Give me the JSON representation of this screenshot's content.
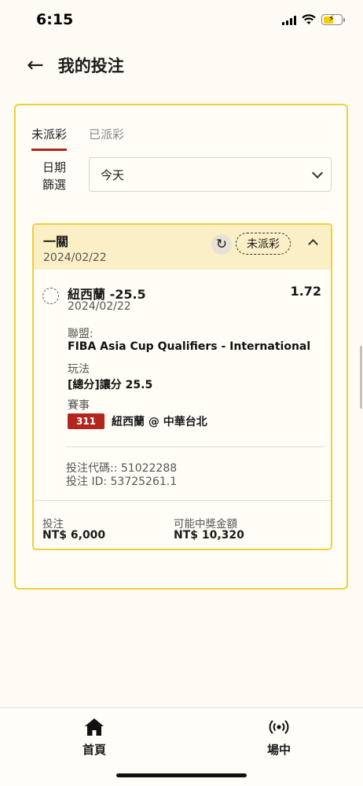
{
  "status_bar": {
    "time": "6:15"
  },
  "header": {
    "title": "我的投注"
  },
  "tabs": [
    {
      "label": "未派彩",
      "active": true
    },
    {
      "label": "已派彩",
      "active": false
    }
  ],
  "filter": {
    "label_line1": "日期",
    "label_line2": "篩選",
    "value": "今天"
  },
  "bet": {
    "type": "一關",
    "date": "2024/02/22",
    "status": "未派彩",
    "selection": "紐西蘭 -25.5",
    "odds": "1.72",
    "selection_date": "2024/02/22",
    "league_label": "聯盟:",
    "league": "FIBA Asia Cup Qualifiers - International",
    "market_label": "玩法",
    "market": "[總分]讓分 25.5",
    "event_label": "賽事",
    "event_code": "311",
    "event": "紐西蘭 @ 中華台北",
    "bet_code": "投注代碼:: 51022288",
    "bet_id": "投注 ID: 53725261.1",
    "stake_label": "投注",
    "stake": "NT$ 6,000",
    "payout_label": "可能中獎金額",
    "payout": "NT$ 10,320"
  },
  "nav": [
    {
      "label": "首頁",
      "icon": "home-icon"
    },
    {
      "label": "場中",
      "icon": "live-broadcast-icon"
    }
  ],
  "colors": {
    "accent": "#b3261e",
    "border": "#f2cf3a",
    "header_bg": "#fbefc5"
  }
}
